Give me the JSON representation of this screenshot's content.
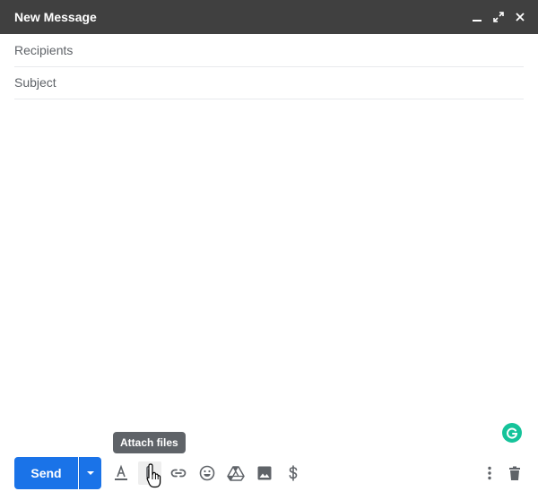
{
  "window": {
    "title": "New Message"
  },
  "fields": {
    "recipients_placeholder": "Recipients",
    "subject_placeholder": "Subject"
  },
  "toolbar": {
    "send_label": "Send",
    "tooltip": "Attach files",
    "icons": [
      "formatting-icon",
      "attach-icon",
      "link-icon",
      "emoji-icon",
      "drive-icon",
      "photo-icon",
      "dollar-icon",
      "more-options-icon",
      "trash-icon"
    ]
  },
  "colors": {
    "titlebar": "#404040",
    "send": "#1a73e8",
    "grammarly": "#15c39a",
    "icon": "#5f6368"
  }
}
